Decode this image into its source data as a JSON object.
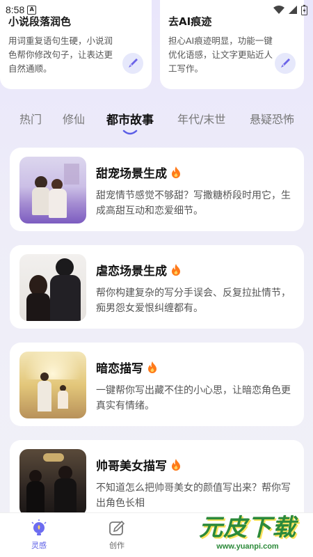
{
  "status": {
    "time": "8:58"
  },
  "top_cards": [
    {
      "title": "小说段落润色",
      "desc": "用词重复语句生硬，小说润色帮你修改句子，让表达更自然通顺。"
    },
    {
      "title": "去AI痕迹",
      "desc": "担心AI痕迹明显，功能一键优化语感，让文字更贴近人工写作。"
    }
  ],
  "tabs": [
    "热门",
    "修仙",
    "都市故事",
    "年代/末世",
    "悬疑恐怖"
  ],
  "active_tab": "都市故事",
  "cards": [
    {
      "title": "甜宠场景生成",
      "desc": "甜宠情节感觉不够甜？写撒糖桥段时用它，生成高甜互动和恋爱细节。"
    },
    {
      "title": "虐恋场景生成",
      "desc": "帮你构建复杂的写分手误会、反复拉扯情节，痴男怨女爱恨纠缠都有。"
    },
    {
      "title": "暗恋描写",
      "desc": "一键帮你写出藏不住的小心思，让暗恋角色更真实有情绪。"
    },
    {
      "title": "帅哥美女描写",
      "desc": "不知道怎么把帅哥美女的颜值写出来？帮你写出角色长相"
    }
  ],
  "nav": [
    {
      "label": "灵感",
      "icon": "lightbulb-icon",
      "active": true
    },
    {
      "label": "创作",
      "icon": "pen-icon",
      "active": false
    }
  ],
  "watermark": {
    "big": "元皮下载",
    "small": "www.yuanpi.com"
  },
  "colors": {
    "accent": "#5a5de6",
    "fire": "#ff7a1a"
  }
}
